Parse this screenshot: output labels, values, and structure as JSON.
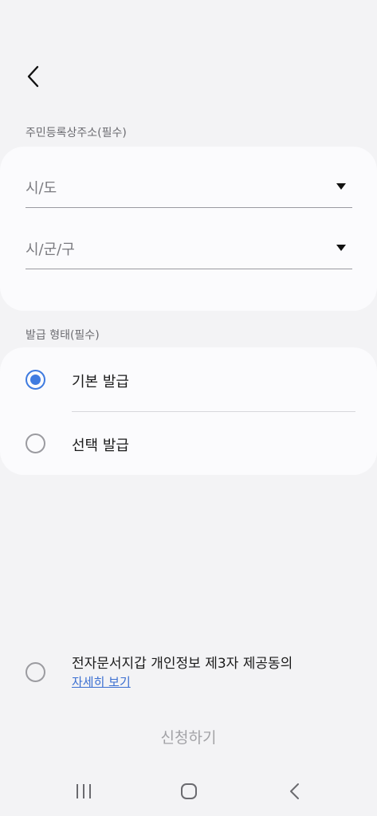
{
  "address_section": {
    "label": "주민등록상주소(필수)",
    "city_placeholder": "시/도",
    "district_placeholder": "시/군/구"
  },
  "issue_type_section": {
    "label": "발급 형태(필수)",
    "options": [
      {
        "label": "기본 발급",
        "selected": true
      },
      {
        "label": "선택 발급",
        "selected": false
      }
    ]
  },
  "consent": {
    "text": "전자문서지갑 개인정보 제3자 제공동의",
    "link_label": "자세히 보기",
    "checked": false
  },
  "submit": {
    "label": "신청하기"
  },
  "colors": {
    "accent": "#3f7be0",
    "link": "#3b6fd1",
    "background": "#f3f3f5",
    "card": "#fbfbfd",
    "disabled_text": "#a2a2a6"
  },
  "icons": {
    "back": "chevron-left-icon",
    "dropdown": "caret-down-icon",
    "nav_recents": "recents-icon",
    "nav_home": "home-icon",
    "nav_back": "back-icon"
  }
}
